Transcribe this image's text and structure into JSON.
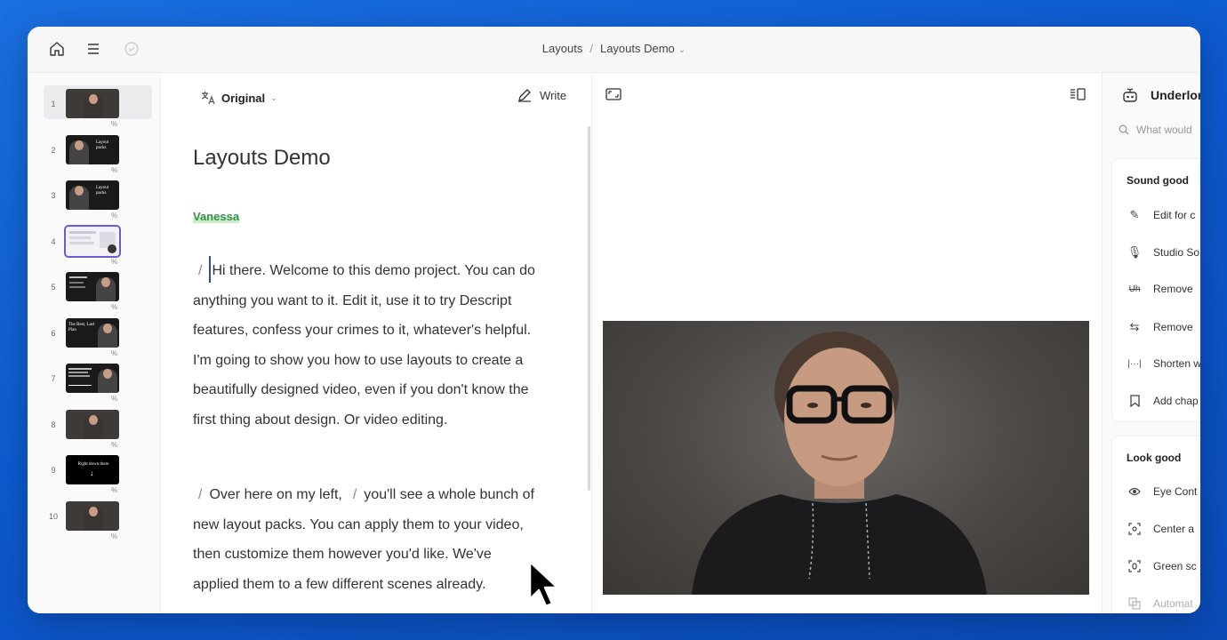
{
  "breadcrumb": {
    "parent": "Layouts",
    "separator": "/",
    "current": "Layouts Demo"
  },
  "scenes": [
    {
      "num": "1",
      "text": ""
    },
    {
      "num": "2",
      "text": "Layout packs"
    },
    {
      "num": "3",
      "text": "Layout packs"
    },
    {
      "num": "4",
      "text": ""
    },
    {
      "num": "5",
      "text": ""
    },
    {
      "num": "6",
      "text": "The Best, Last Plan"
    },
    {
      "num": "7",
      "text": ""
    },
    {
      "num": "8",
      "text": ""
    },
    {
      "num": "9",
      "text": "Right down there"
    },
    {
      "num": "10",
      "text": ""
    }
  ],
  "editor": {
    "original_label": "Original",
    "write_label": "Write",
    "title": "Layouts Demo",
    "speaker": "Vanessa",
    "slash": "/",
    "para1": "Hi there. Welcome to this demo project. You can do anything you want to it. Edit it, use it to try Descript features, confess your crimes to it, whatever's helpful. I'm going to show you how to use layouts to create a beautifully designed video, even if you don't know the first thing about design. Or video editing.",
    "para2_a": "Over here on my left,",
    "para2_b": "you'll see a whole bunch of new layout packs. You can apply them to your video, then customize them however you'd like. We've applied them to a few different scenes already."
  },
  "right_panel": {
    "title": "Underlord",
    "search_placeholder": "What would",
    "sound_good": {
      "heading": "Sound good",
      "items": [
        "Edit for c",
        "Studio So",
        "Remove",
        "Remove",
        "Shorten w",
        "Add chap"
      ]
    },
    "look_good": {
      "heading": "Look good",
      "items": [
        "Eye Cont",
        "Center a",
        "Green sc",
        "Automat"
      ]
    }
  },
  "colors": {
    "accent": "#6b5bd2",
    "speaker_green": "#3a8f4a",
    "cursor_blue": "#2c4bb8",
    "background_blue": "#0d5ad0"
  }
}
